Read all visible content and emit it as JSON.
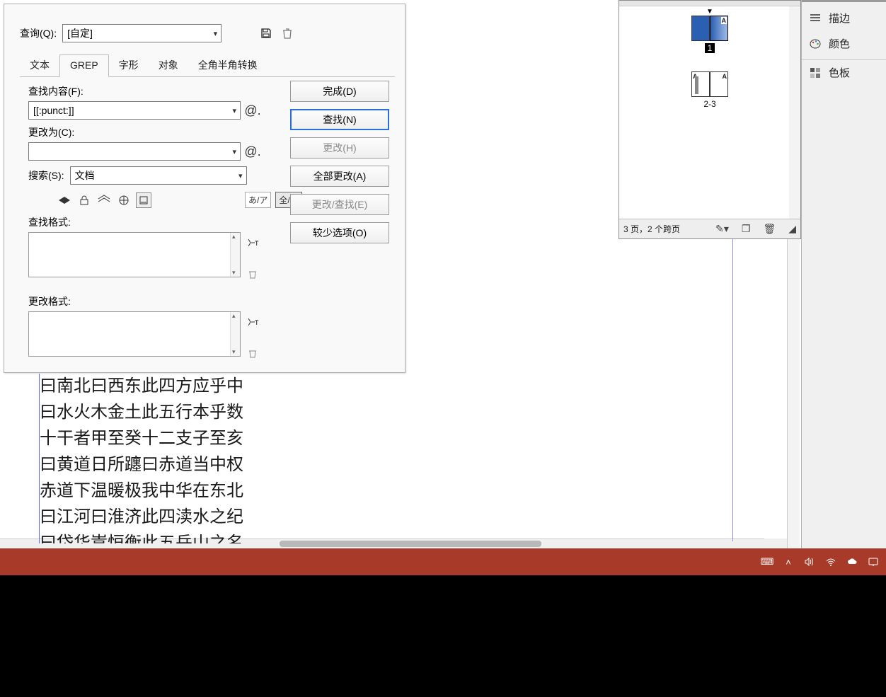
{
  "dialog": {
    "query_label": "查询(Q):",
    "query_value": "[自定]",
    "save_icon": "save",
    "trash_icon": "trash",
    "tabs": {
      "text": "文本",
      "grep": "GREP",
      "glyph": "字形",
      "object": "对象",
      "fullhalf": "全角半角转换"
    },
    "find_what_label": "查找内容(F):",
    "find_what_value": "[[:punct:]]",
    "change_to_label": "更改为(C):",
    "change_to_value": "",
    "search_label": "搜索(S):",
    "search_value": "文档",
    "find_format_label": "查找格式:",
    "change_format_label": "更改格式:",
    "option_group_a": "あ/ア",
    "option_group_b": "全/半",
    "buttons": {
      "done": "完成(D)",
      "find_next": "查找(N)",
      "change": "更改(H)",
      "change_all": "全部更改(A)",
      "change_find": "更改/查找(E)",
      "fewer_options": "较少选项(O)"
    }
  },
  "document_lines": [
    "曰南北曰西东此四方应乎中",
    "曰水火木金土此五行本乎数",
    "十干者甲至癸十二支子至亥",
    "曰黄道日所躔曰赤道当中权",
    "赤道下温暖极我中华在东北",
    "曰江河曰淮济此四渎水之纪",
    "曰岱华嵩恒衡此五岳山之名"
  ],
  "pages_panel": {
    "marker": "A",
    "page1_label": "1",
    "spread_label": "2-3",
    "status": "3 页，2 个跨页"
  },
  "side_panels": {
    "stroke": "描边",
    "color": "颜色",
    "swatches": "色板"
  }
}
